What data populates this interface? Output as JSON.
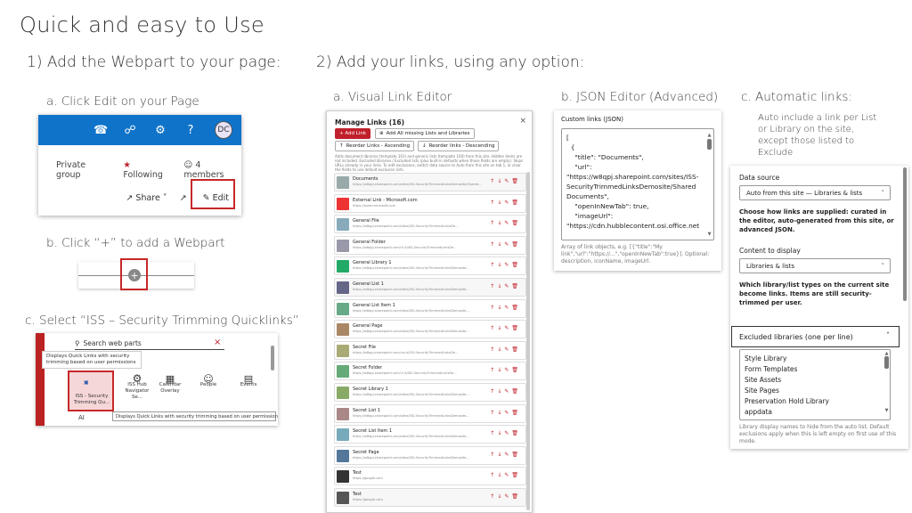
{
  "title": "Quick and easy to Use",
  "step1": "1) Add the Webpart to your page:",
  "step2": "2) Add your links, using any option:",
  "a1": "a. Click Edit on your Page",
  "b1": "b. Click “+” to add a Webpart",
  "c1": "c. Select “ISS – Security Trimming Quicklinks”",
  "a2": "a. Visual Link Editor",
  "b2": "b. JSON Editor (Advanced)",
  "c2": "c. Automatic links:",
  "auto_desc": [
    "Auto include a link per List",
    "or Library on the site,",
    "except those listed to",
    "Exclude"
  ],
  "sp": {
    "dc": "DC",
    "private_group": "Private group",
    "following": "Following",
    "members": "4 members",
    "share": "Share",
    "edit": "Edit"
  },
  "wp": {
    "search": "Search web parts",
    "tooltip": [
      "Displays Quick Links with security",
      "trimming based on user permissions"
    ],
    "items": [
      "ISS - Security Trimming Qu...",
      "ISS Hub Navigator Se...",
      "Calendar Overlay",
      "People",
      "Events"
    ],
    "ai": "AI",
    "desc": "Displays Quick Links with security trimming based on user permissions"
  },
  "ql": {
    "title": "Manage Links (16)",
    "add": "+  Add Link",
    "add_all": "Add All missing Lists and Libraries",
    "asc": "Reorder Links - Ascending",
    "desc": "Reorder links - Descending",
    "note": "Adds document libraries (template 101) and generic lists (template 100) from this site. Hidden items are not included. Excluded libraries / Excluded lists (plus built-in defaults when those fields are empty). Skips URLs already in your links. To edit exclusions, switch data source to Auto from this site on tab 1, or clear the fields to use default exclusion lists.",
    "links": [
      {
        "t": "Documents",
        "u": "https://w8qpj.sharepoint.com/sites/ISS-SecurityTrimmedLinksDemosite/Shared..."
      },
      {
        "t": "External Link - Microsoft.com",
        "u": "https://www.microsoft.com"
      },
      {
        "t": "General File",
        "u": "https://w8qpj.sharepoint.com/sites/ISS-SecurityTrimmedLinksDe..."
      },
      {
        "t": "General Folder",
        "u": "https://w8qpj.sharepoint.com/:f:/s/ISS-SecurityTrimmedLinksDe..."
      },
      {
        "t": "General Library 1",
        "u": "https://w8qpj.sharepoint.com/sites/ISS-SecurityTrimmedLinksDemosite..."
      },
      {
        "t": "General List 1",
        "u": "https://w8qpj.sharepoint.com/sites/ISS-SecurityTrimmedLinksDemosite..."
      },
      {
        "t": "General List Item 1",
        "u": "https://w8qpj.sharepoint.com/sites/ISS-SecurityTrimmedLinksDemosite..."
      },
      {
        "t": "General Page",
        "u": "https://w8qpj.sharepoint.com/sites/ISS-SecurityTrimmedLinksDemosite..."
      },
      {
        "t": "Secret File",
        "u": "https://w8qpj.sharepoint.com/:w:/s/ISS-SecurityTrimmedLinksDe..."
      },
      {
        "t": "Secret Folder",
        "u": "https://w8qpj.sharepoint.com/:f:/s/ISS-SecurityTrimmedLinksDe..."
      },
      {
        "t": "Secret Library 1",
        "u": "https://w8qpj.sharepoint.com/sites/ISS-SecurityTrimmedLinksDemosite..."
      },
      {
        "t": "Secret List 1",
        "u": "https://w8qpj.sharepoint.com/sites/ISS-SecurityTrimmedLinksDemosite..."
      },
      {
        "t": "Secret List Item 1",
        "u": "https://w8qpj.sharepoint.com/sites/ISS-SecurityTrimmedLinksDemosite..."
      },
      {
        "t": "Secret Page",
        "u": "https://w8qpj.sharepoint.com/sites/ISS-SecurityTrimmedLinksDemosite..."
      },
      {
        "t": "Test",
        "u": "https://google.com"
      },
      {
        "t": "Test",
        "u": "https://google.com"
      }
    ]
  },
  "json": {
    "label": "Custom links (JSON)",
    "code": "[\n  {\n    \"title\": \"Documents\",\n    \"url\":\n\"https://w8qpj.sharepoint.com/sites/ISS-\nSecurityTrimmedLinksDemosite/Shared\nDocuments\",\n    \"openInNewTab\": true,\n    \"imageUrl\":\n\"https://cdn.hubblecontent.osi.office.net",
    "help": "Array of link objects, e.g. [{\"title\":\"My link\",\"url\":\"https://...\",\"openInNewTab\":true}]. Optional: description, iconName, imageUrl."
  },
  "auto": {
    "ds_label": "Data source",
    "ds_value": "Auto from this site — Libraries & lists",
    "ds_help": "Choose how links are supplied: curated in the editor, auto-generated from this site, or advanced JSON.",
    "ct_label": "Content to display",
    "ct_value": "Libraries & lists",
    "ct_help": "Which library/list types on the current site become links. Items are still security-trimmed per user.",
    "exc_label": "Excluded libraries (one per line)",
    "exc_items": [
      "Style Library",
      "Form Templates",
      "Site Assets",
      "Site Pages",
      "Preservation Hold Library",
      "appdata"
    ],
    "exc_help": "Library display names to hide from the auto list. Default exclusions apply when this is left empty on first use of this mode."
  }
}
